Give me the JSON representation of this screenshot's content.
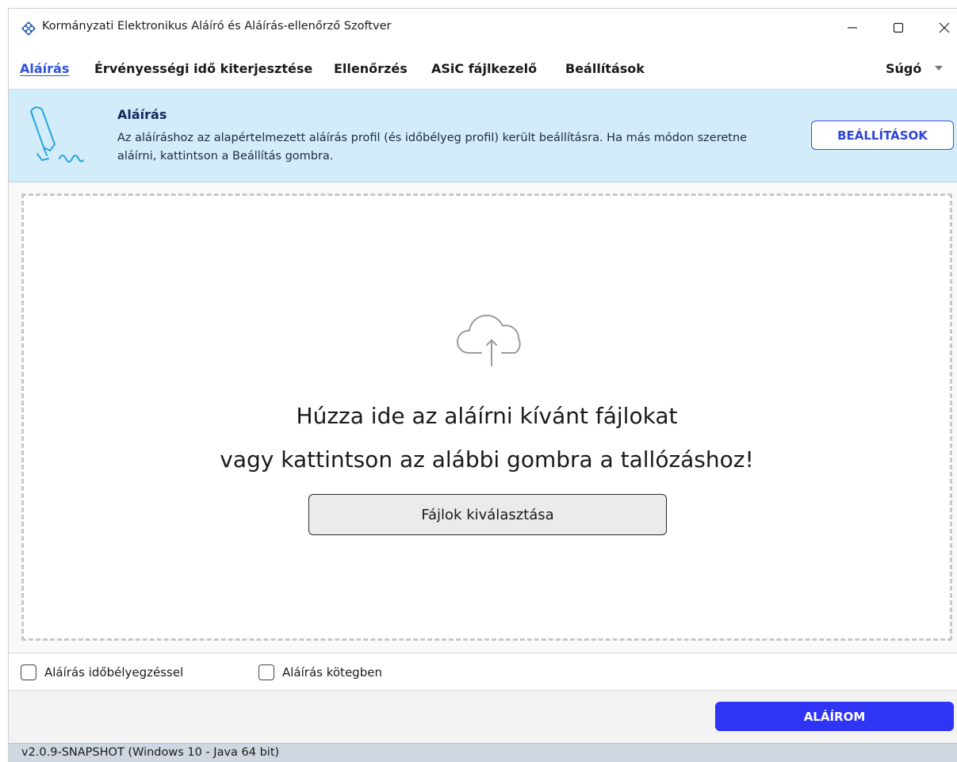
{
  "window": {
    "title": "Kormányzati Elektronikus Aláíró és Aláírás-ellenőrző Szoftver",
    "controls": [
      "minimize-icon",
      "maximize-icon",
      "close-icon"
    ]
  },
  "menu": {
    "items": [
      {
        "label": "Aláírás",
        "active": true
      },
      {
        "label": "Érvényességi idő kiterjesztése",
        "active": false
      },
      {
        "label": "Ellenőrzés",
        "active": false
      },
      {
        "label": "ASiC fájlkezelő",
        "active": false
      },
      {
        "label": "Beállítások",
        "active": false
      }
    ],
    "help_label": "Súgó",
    "active_color": "#2e52d9"
  },
  "banner": {
    "title": "Aláírás",
    "text": "Az aláíráshoz az alapértelmezett aláírás profil (és időbélyeg profil) került beállításra. Ha más módon szeretne aláírni, kattintson a Beállítás gombra.",
    "settings_button": "BEÁLLÍTÁSOK",
    "background": "#d2ecf9",
    "icon": "pen-signature-icon"
  },
  "dropzone": {
    "line1": "Húzza ide az aláírni kívánt fájlokat",
    "line2": "vagy kattintson az alábbi gombra a tallózáshoz!",
    "button": "Fájlok kiválasztása",
    "icon": "cloud-upload-icon"
  },
  "options": {
    "timestamp": {
      "label": "Aláírás időbélyegzéssel",
      "checked": false
    },
    "batch": {
      "label": "Aláírás kötegben",
      "checked": false
    }
  },
  "actions": {
    "sign_button": "ALÁÍROM",
    "sign_color": "#2f34f5"
  },
  "status": {
    "text": "v2.0.9-SNAPSHOT (Windows 10 - Java 64 bit)"
  }
}
